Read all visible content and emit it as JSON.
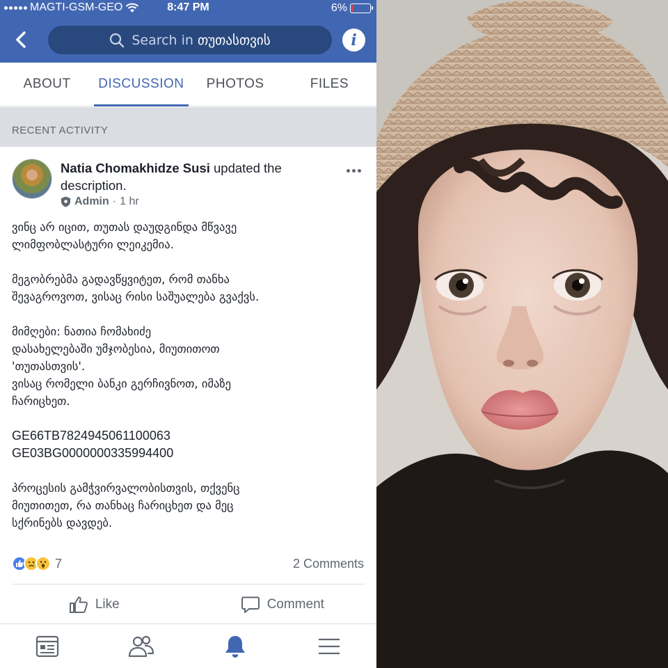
{
  "status_bar": {
    "carrier": "MAGTI-GSM-GEO",
    "time": "8:47 PM",
    "battery_percent": "6%",
    "battery_level": 0.06,
    "wifi_icon": "wifi-icon"
  },
  "nav": {
    "back_icon": "chevron-left-icon",
    "search_prefix": "Search in",
    "search_group": "თუთასთვის",
    "info_icon": "info-icon"
  },
  "tabs": [
    {
      "label": "ABOUT",
      "active": false
    },
    {
      "label": "DISCUSSION",
      "active": true
    },
    {
      "label": "PHOTOS",
      "active": false
    },
    {
      "label": "FILES",
      "active": false
    }
  ],
  "section_header": "RECENT ACTIVITY",
  "post": {
    "author": "Natia Chomakhidze Susi",
    "action": "updated the description.",
    "role": "Admin",
    "separator": "·",
    "time": "1 hr",
    "body": {
      "p1": [
        "ვინც არ იცით, თუთას დაუდგინდა მწვავე",
        "ლიმფობლასტური ლეიკემია."
      ],
      "p2": [
        "მეგობრებმა გადავწყვიტეთ, რომ თანხა",
        "შევაგროვოთ, ვისაც რისი საშუალება გვაქვს."
      ],
      "p3": [
        "მიმღები: ნათია ჩომახიძე",
        "დასახელებაში უმჯობესია, მიუთითოთ",
        "'თუთასთვის'.",
        "ვისაც რომელი ბანკი გერჩივნოთ, იმაზე",
        "ჩარიცხეთ."
      ],
      "iban1": "GE66TB7824945061100063",
      "iban2": "GE03BG0000000335994400",
      "p5": [
        "პროცესის გამჭვირვალობისთვის, თქვენც",
        "მიუთითეთ, რა თანხაც ჩარიცხეთ და მეც",
        "სქრინებს დავდებ."
      ]
    },
    "reaction_count": "7",
    "comments": "2 Comments",
    "like_label": "Like",
    "comment_label": "Comment"
  },
  "bottom_bar": [
    "news-feed-icon",
    "groups-icon",
    "notifications-bell-icon",
    "menu-icon"
  ],
  "colors": {
    "brand": "#4267b2",
    "search_bg": "#29487d",
    "section_bg": "#dadde1",
    "text": "#1d2129",
    "muted": "#606770"
  }
}
